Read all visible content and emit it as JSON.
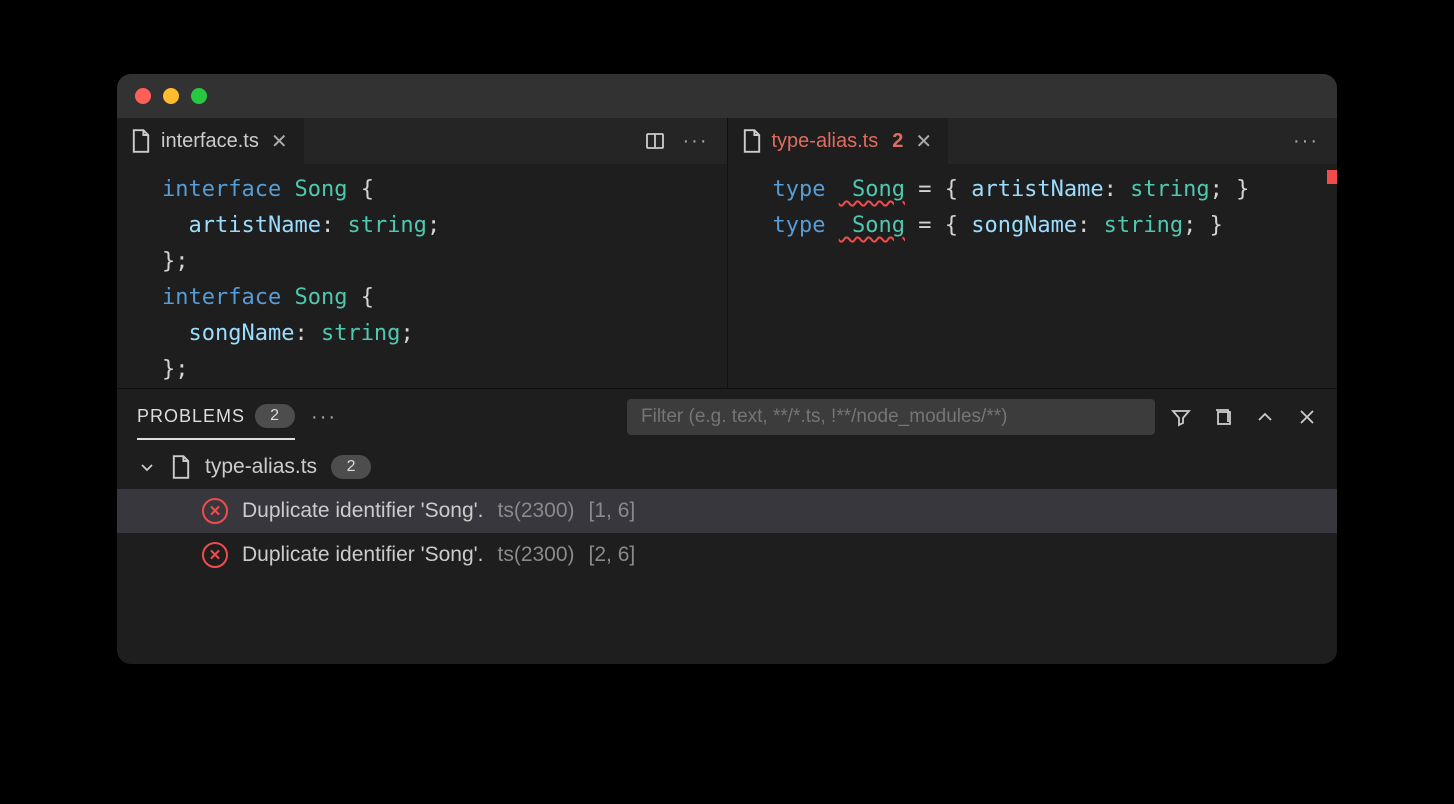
{
  "window": {
    "traffic": [
      "close",
      "minimize",
      "zoom"
    ]
  },
  "editors": {
    "left": {
      "tab": {
        "filename": "interface.ts",
        "dirty": false
      },
      "code": {
        "l1a": "interface",
        "l1b": " Song",
        " l1c": " {",
        "l2a": "  artistName",
        "l2b": ": ",
        "l2c": "string",
        "l2d": ";",
        "l3": "};",
        "l4a": "interface",
        "l4b": " Song",
        "l4c": " {",
        "l5a": "  songName",
        "l5b": ": ",
        "l5c": "string",
        "l5d": ";",
        "l6": "};"
      }
    },
    "right": {
      "tab": {
        "filename": "type-alias.ts",
        "error_count": "2"
      },
      "code": {
        "l1a": "type",
        "l1b": " Song",
        "l1c": " = { ",
        "l1d": "artistName",
        "l1e": ": ",
        "l1f": "string",
        "l1g": "; }",
        "l2a": "type",
        "l2b": " Song",
        "l2c": " = { ",
        "l2d": "songName",
        "l2e": ": ",
        "l2f": "string",
        "l2g": "; }"
      }
    }
  },
  "panel": {
    "tab_label": "PROBLEMS",
    "tab_count": "2",
    "filter_placeholder": "Filter (e.g. text, **/*.ts, !**/node_modules/**)",
    "group": {
      "filename": "type-alias.ts",
      "count": "2"
    },
    "items": [
      {
        "msg": "Duplicate identifier 'Song'.",
        "code": "ts(2300)",
        "loc": "[1, 6]"
      },
      {
        "msg": "Duplicate identifier 'Song'.",
        "code": "ts(2300)",
        "loc": "[2, 6]"
      }
    ]
  }
}
